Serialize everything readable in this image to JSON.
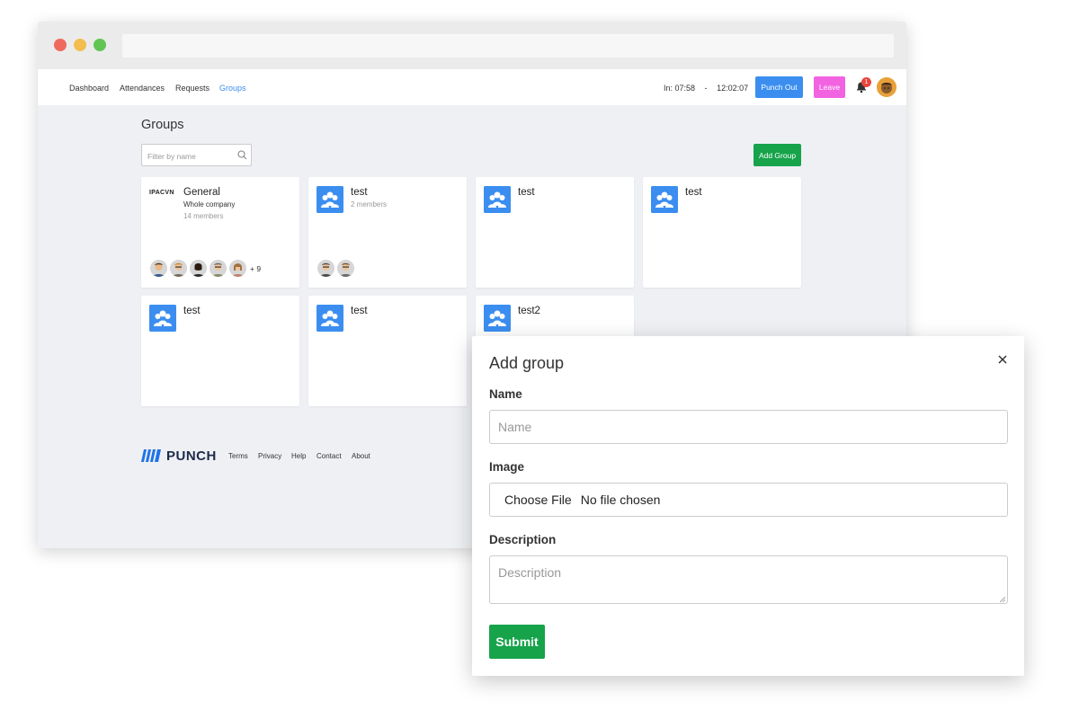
{
  "nav": {
    "links": [
      "Dashboard",
      "Attendances",
      "Requests",
      "Groups"
    ],
    "punch_in": "In: 07:58",
    "separator": "-",
    "current_time": "12:02:07",
    "punch_out_label": "Punch Out",
    "leave_label": "Leave",
    "notification_count": "1"
  },
  "page": {
    "title": "Groups",
    "filter_placeholder": "Filter by name",
    "add_group_label": "Add Group"
  },
  "groups": [
    {
      "name": "General",
      "logo": "IPACVN",
      "subtitle": "Whole company",
      "members": "14 members",
      "more": "+ 9"
    },
    {
      "name": "test",
      "members": "2 members"
    },
    {
      "name": "test"
    },
    {
      "name": "test"
    },
    {
      "name": "test"
    },
    {
      "name": "test"
    },
    {
      "name": "test2"
    }
  ],
  "footer": {
    "brand": "PUNCH",
    "links": [
      "Terms",
      "Privacy",
      "Help",
      "Contact",
      "About"
    ]
  },
  "modal": {
    "title": "Add group",
    "name_label": "Name",
    "name_placeholder": "Name",
    "image_label": "Image",
    "file_button": "Choose File",
    "file_status": "No file chosen",
    "description_label": "Description",
    "description_placeholder": "Description",
    "submit_label": "Submit"
  },
  "colors": {
    "primary": "#3b8ef0",
    "success": "#16a34a",
    "leave": "#f263e2",
    "background": "#eef0f4"
  }
}
